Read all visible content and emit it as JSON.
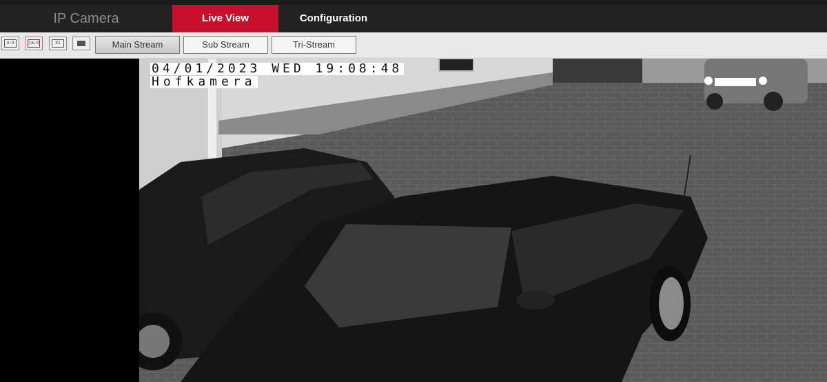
{
  "header": {
    "brand": "IP Camera",
    "tabs": [
      {
        "label": "Live View",
        "active": true
      },
      {
        "label": "Configuration",
        "active": false
      }
    ],
    "accent_color": "#c8102e"
  },
  "toolbar": {
    "ratio_buttons": [
      {
        "label": "4:3",
        "icon": "aspect-4-3-icon",
        "active": false
      },
      {
        "label": "16:9",
        "icon": "aspect-16-9-icon",
        "active": true
      },
      {
        "label": "X1",
        "icon": "original-size-icon",
        "active": false
      },
      {
        "label": "",
        "icon": "fullscreen-icon",
        "active": false
      }
    ],
    "streams": [
      {
        "label": "Main Stream",
        "active": true
      },
      {
        "label": "Sub Stream",
        "active": false
      },
      {
        "label": "Tri-Stream",
        "active": false
      }
    ]
  },
  "video": {
    "osd_datetime": "04/01/2023 WED 19:08:48",
    "osd_camera_name": "Hofkamera"
  }
}
